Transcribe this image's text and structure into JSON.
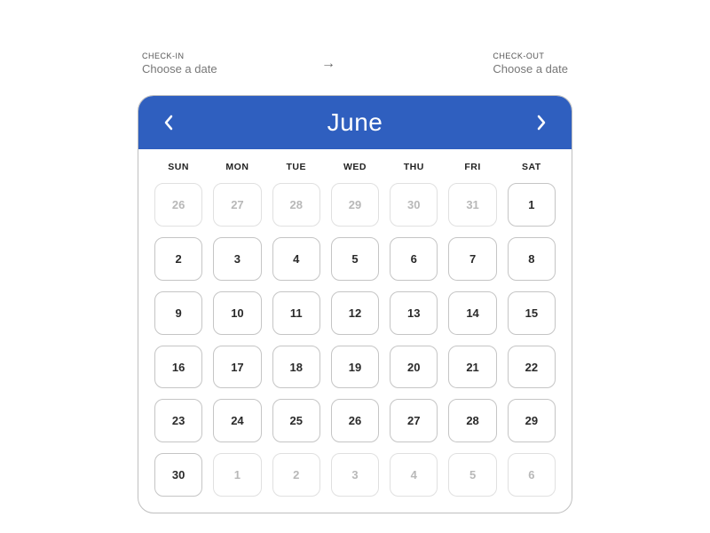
{
  "checkin": {
    "label": "CHECK-IN",
    "value": "Choose  a date"
  },
  "checkout": {
    "label": "CHECK-OUT",
    "value": "Choose  a date"
  },
  "calendar": {
    "month": "June",
    "weekdays": [
      "SUN",
      "MON",
      "TUE",
      "WED",
      "THU",
      "FRI",
      "SAT"
    ],
    "days": [
      {
        "n": 26,
        "muted": true
      },
      {
        "n": 27,
        "muted": true
      },
      {
        "n": 28,
        "muted": true
      },
      {
        "n": 29,
        "muted": true
      },
      {
        "n": 30,
        "muted": true
      },
      {
        "n": 31,
        "muted": true
      },
      {
        "n": 1,
        "muted": false
      },
      {
        "n": 2,
        "muted": false
      },
      {
        "n": 3,
        "muted": false
      },
      {
        "n": 4,
        "muted": false
      },
      {
        "n": 5,
        "muted": false
      },
      {
        "n": 6,
        "muted": false
      },
      {
        "n": 7,
        "muted": false
      },
      {
        "n": 8,
        "muted": false
      },
      {
        "n": 9,
        "muted": false
      },
      {
        "n": 10,
        "muted": false
      },
      {
        "n": 11,
        "muted": false
      },
      {
        "n": 12,
        "muted": false
      },
      {
        "n": 13,
        "muted": false
      },
      {
        "n": 14,
        "muted": false
      },
      {
        "n": 15,
        "muted": false
      },
      {
        "n": 16,
        "muted": false
      },
      {
        "n": 17,
        "muted": false
      },
      {
        "n": 18,
        "muted": false
      },
      {
        "n": 19,
        "muted": false
      },
      {
        "n": 20,
        "muted": false
      },
      {
        "n": 21,
        "muted": false
      },
      {
        "n": 22,
        "muted": false
      },
      {
        "n": 23,
        "muted": false
      },
      {
        "n": 24,
        "muted": false
      },
      {
        "n": 25,
        "muted": false
      },
      {
        "n": 26,
        "muted": false
      },
      {
        "n": 27,
        "muted": false
      },
      {
        "n": 28,
        "muted": false
      },
      {
        "n": 29,
        "muted": false
      },
      {
        "n": 30,
        "muted": false
      },
      {
        "n": 1,
        "muted": true
      },
      {
        "n": 2,
        "muted": true
      },
      {
        "n": 3,
        "muted": true
      },
      {
        "n": 4,
        "muted": true
      },
      {
        "n": 5,
        "muted": true
      },
      {
        "n": 6,
        "muted": true
      }
    ]
  },
  "colors": {
    "primary": "#2f5fbf"
  }
}
